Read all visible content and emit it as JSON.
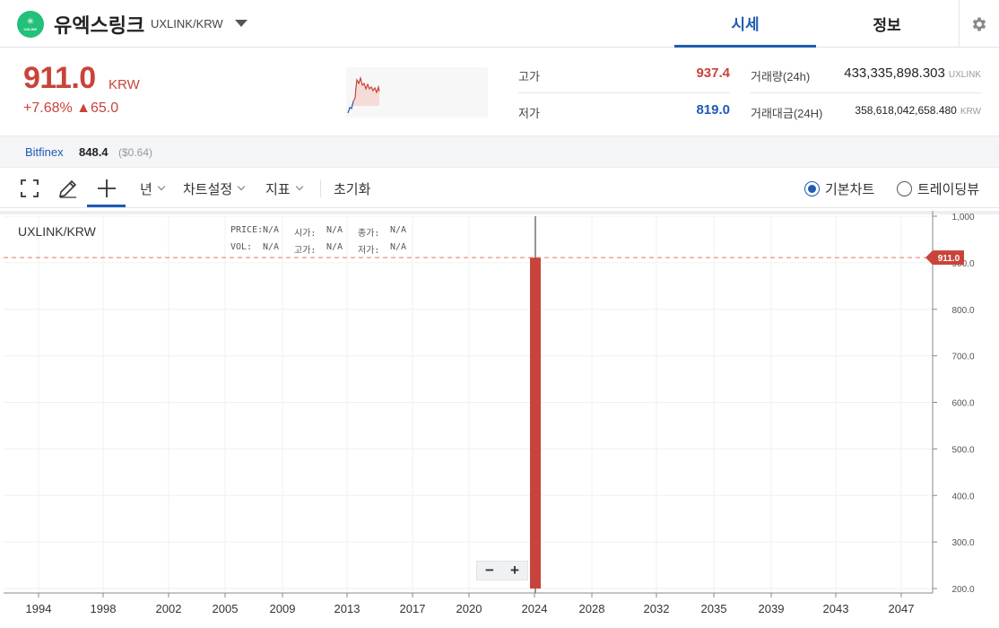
{
  "header": {
    "logo_symbol": "✳",
    "logo_text": "UXLINK",
    "coin_name": "유엑스링크",
    "pair": "UXLINK/KRW",
    "tabs": [
      "시세",
      "정보"
    ]
  },
  "price": {
    "current": "911.0",
    "unit": "KRW",
    "change_pct": "+7.68%",
    "change_abs": "▲65.0",
    "high_label": "고가",
    "high_value": "937.4",
    "low_label": "저가",
    "low_value": "819.0",
    "volume_label": "거래량(24h)",
    "volume_value": "433,335,898.303",
    "volume_unit": "UXLINK",
    "turnover_label": "거래대금(24H)",
    "turnover_value": "358,618,042,658.480",
    "turnover_unit": "KRW"
  },
  "exchange": {
    "name": "Bitfinex",
    "price": "848.4",
    "usd": "($0.64)"
  },
  "toolbar": {
    "period": "년",
    "chart_settings": "차트설정",
    "indicators": "지표",
    "reset": "초기화",
    "radio_basic": "기본차트",
    "radio_tradingview": "트레이딩뷰"
  },
  "colors": {
    "accent": "#1f5bb5",
    "up": "#c8443a",
    "down": "#1f5bb5",
    "brand": "#22c07a"
  },
  "ohlc": {
    "price_label": "PRICE:",
    "vol_label": "VOL:",
    "open_label": "시가:",
    "high_label": "고가:",
    "close_label": "종가:",
    "low_label": "저가:",
    "na": "N/A"
  },
  "chart_data": {
    "type": "bar",
    "title": "UXLINK/KRW",
    "x_ticks": [
      "1994",
      "1998",
      "2002",
      "2005",
      "2009",
      "2013",
      "2017",
      "2020",
      "2024",
      "2028",
      "2032",
      "2035",
      "2039",
      "2043",
      "2047"
    ],
    "y_ticks": [
      "1,000",
      "900.0",
      "800.0",
      "700.0",
      "600.0",
      "500.0",
      "400.0",
      "300.0",
      "200.0"
    ],
    "ylim": [
      200,
      1000
    ],
    "candle": {
      "year": "2024",
      "open": 200,
      "close": 911.0,
      "high": 1000,
      "low": 200
    },
    "last_price_label": "911.0",
    "grid": true
  }
}
